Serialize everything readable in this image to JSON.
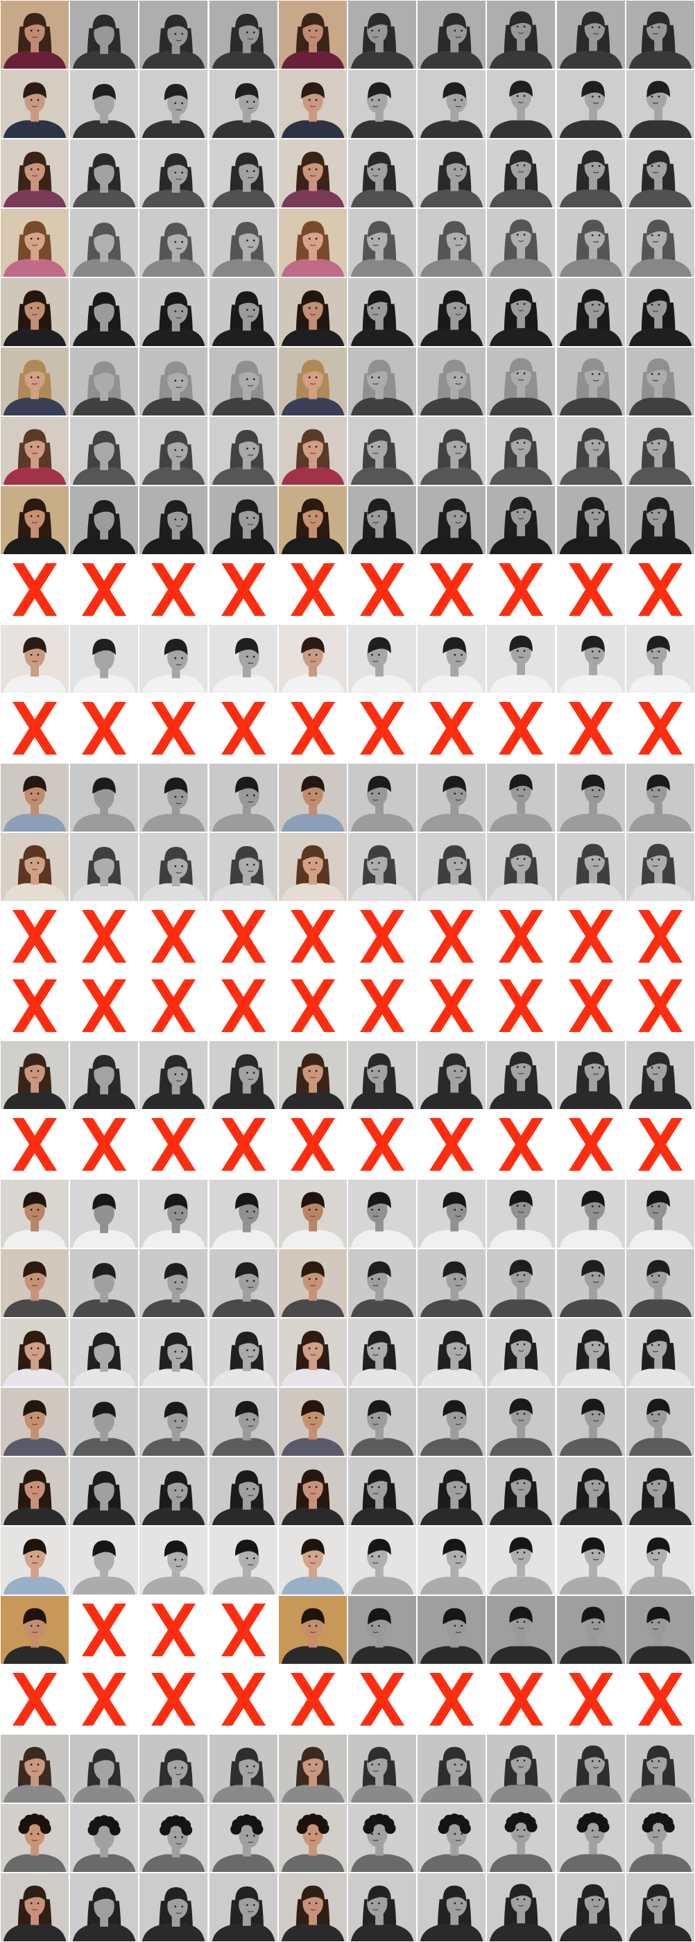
{
  "grid": {
    "columns": 10,
    "rows": 28,
    "pose_columns": [
      "frontal-color",
      "down",
      "down-right",
      "right-down",
      "frontal-color",
      "left",
      "right",
      "up",
      "up-right",
      "up-left"
    ],
    "missing_marker_color": "#ff2d10",
    "row_kinds": [
      "photos",
      "photos",
      "photos",
      "photos",
      "photos",
      "photos",
      "photos",
      "photos",
      "missing",
      "photos",
      "missing",
      "photos",
      "photos",
      "missing",
      "missing",
      "photos",
      "missing",
      "photos",
      "photos",
      "photos",
      "photos",
      "photos",
      "photos",
      "partial",
      "missing",
      "photos",
      "photos",
      "photos"
    ],
    "partial_missing_columns": [
      1,
      2,
      3
    ],
    "subjects": [
      {
        "hair": "long-dark",
        "bg": "#c7a888",
        "skin": "#c28a72",
        "hairColor": "#3b2418",
        "shirt": "#6a2038"
      },
      {
        "hair": "short-dark",
        "bg": "#d5ccc2",
        "skin": "#c99a80",
        "hairColor": "#2a1c14",
        "shirt": "#2c3344"
      },
      {
        "hair": "long-dark",
        "bg": "#d8cfc6",
        "skin": "#c9957c",
        "hairColor": "#3a2418",
        "shirt": "#7a3a5a"
      },
      {
        "hair": "long-brown",
        "bg": "#d8c9b0",
        "skin": "#d6a48a",
        "hairColor": "#7a4a2c",
        "shirt": "#c06a88"
      },
      {
        "hair": "long-dark",
        "bg": "#cfc7b9",
        "skin": "#c28e74",
        "hairColor": "#24160f",
        "shirt": "#1f1f1f"
      },
      {
        "hair": "long-blond",
        "bg": "#c9bfaf",
        "skin": "#d2a083",
        "hairColor": "#b08a56",
        "shirt": "#3a3f58"
      },
      {
        "hair": "long-brown",
        "bg": "#d5cdc4",
        "skin": "#cf9d84",
        "hairColor": "#5a3a28",
        "shirt": "#a23248"
      },
      {
        "hair": "long-dark",
        "bg": "#c8ae86",
        "skin": "#c4906f",
        "hairColor": "#2c1a10",
        "shirt": "#1c1c1c"
      },
      null,
      {
        "hair": "short-dark",
        "bg": "#e8e2de",
        "skin": "#c99b82",
        "hairColor": "#2a1c12",
        "shirt": "#f2f2f2"
      },
      null,
      {
        "hair": "short-dark",
        "bg": "#cdc9c2",
        "skin": "#c18c6e",
        "hairColor": "#241810",
        "shirt": "#8aa0b8"
      },
      {
        "hair": "long-brown",
        "bg": "#d8d0c6",
        "skin": "#d2a184",
        "hairColor": "#5c3620",
        "shirt": "#e6ddd2"
      },
      null,
      null,
      {
        "hair": "long-dark",
        "bg": "#cfcfcc",
        "skin": "#c9977c",
        "hairColor": "#3a2418",
        "shirt": "#2a2a2a"
      },
      null,
      {
        "hair": "short-dark",
        "bg": "#d9d6d2",
        "skin": "#b98566",
        "hairColor": "#1f140e",
        "shirt": "#f0f0f0"
      },
      {
        "hair": "short-dark",
        "bg": "#d3c8bc",
        "skin": "#c79377",
        "hairColor": "#2a1a10",
        "shirt": "#4a4a4a"
      },
      {
        "hair": "long-dark",
        "bg": "#d8d4ce",
        "skin": "#cf9f86",
        "hairColor": "#2e1c12",
        "shirt": "#e8e4ec"
      },
      {
        "hair": "short-dark",
        "bg": "#cfc8c0",
        "skin": "#c4906f",
        "hairColor": "#22160e",
        "shirt": "#5a5a6a"
      },
      {
        "hair": "long-dark",
        "bg": "#cfcac4",
        "skin": "#c99278",
        "hairColor": "#26180f",
        "shirt": "#2a2a2a"
      },
      {
        "hair": "short-dark",
        "bg": "#e6e4e2",
        "skin": "#d4a488",
        "hairColor": "#1e140e",
        "shirt": "#9ab0c8"
      },
      {
        "hair": "short-dark",
        "bg": "#c89858",
        "skin": "#c48d6c",
        "hairColor": "#1e140c",
        "shirt": "#2a2a2a"
      },
      null,
      {
        "hair": "long-dark",
        "bg": "#c8c6c2",
        "skin": "#c9987e",
        "hairColor": "#3a2a20",
        "shirt": "#8a8a8a"
      },
      {
        "hair": "curly-dark",
        "bg": "#d2cfca",
        "skin": "#c99478",
        "hairColor": "#1c120c",
        "shirt": "#6a6a6a"
      },
      {
        "hair": "long-dark",
        "bg": "#cfcbc6",
        "skin": "#c99278",
        "hairColor": "#2e1e14",
        "shirt": "#2a2a2a"
      }
    ]
  }
}
